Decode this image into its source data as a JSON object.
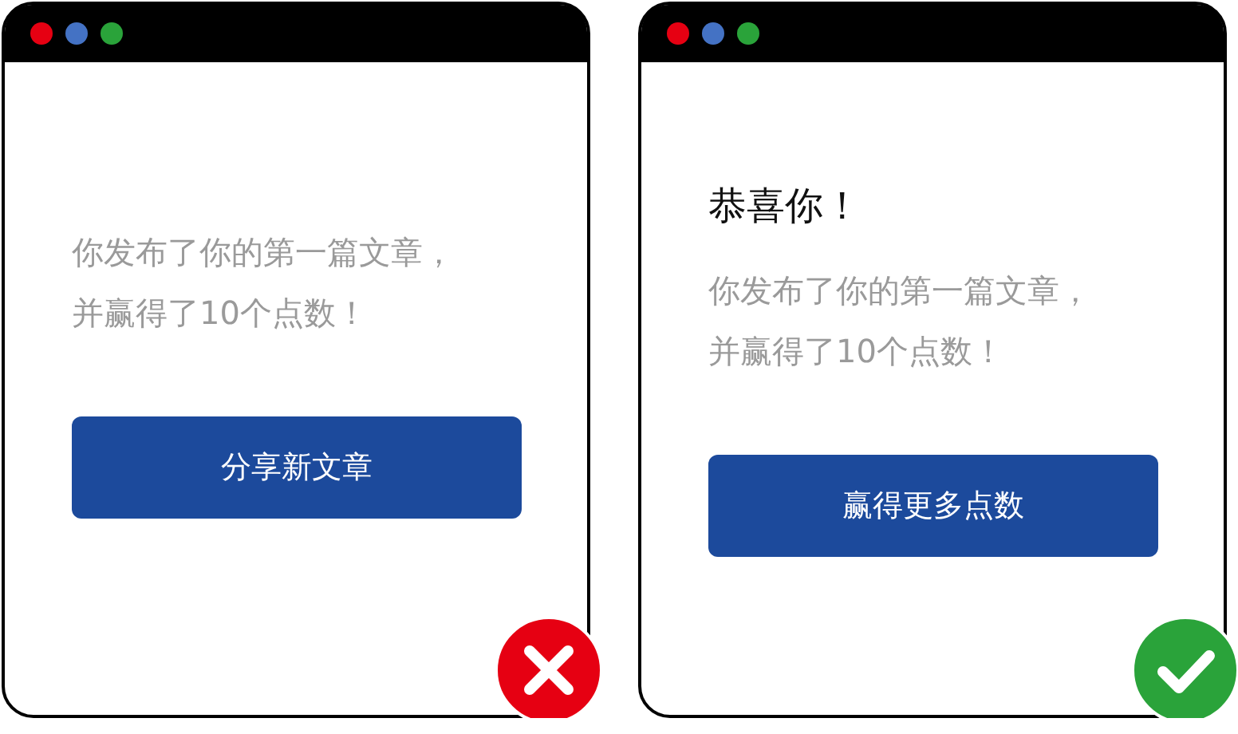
{
  "windows": [
    {
      "message_lines": [
        "你发布了你的第一篇文章，",
        "并赢得了10个点数！"
      ],
      "button": "分享新文章",
      "kind": "wrong"
    },
    {
      "heading": "恭喜你！",
      "message_lines": [
        "你发布了你的第一篇文章，",
        "并赢得了10个点数！"
      ],
      "button": "赢得更多点数",
      "kind": "right"
    }
  ]
}
